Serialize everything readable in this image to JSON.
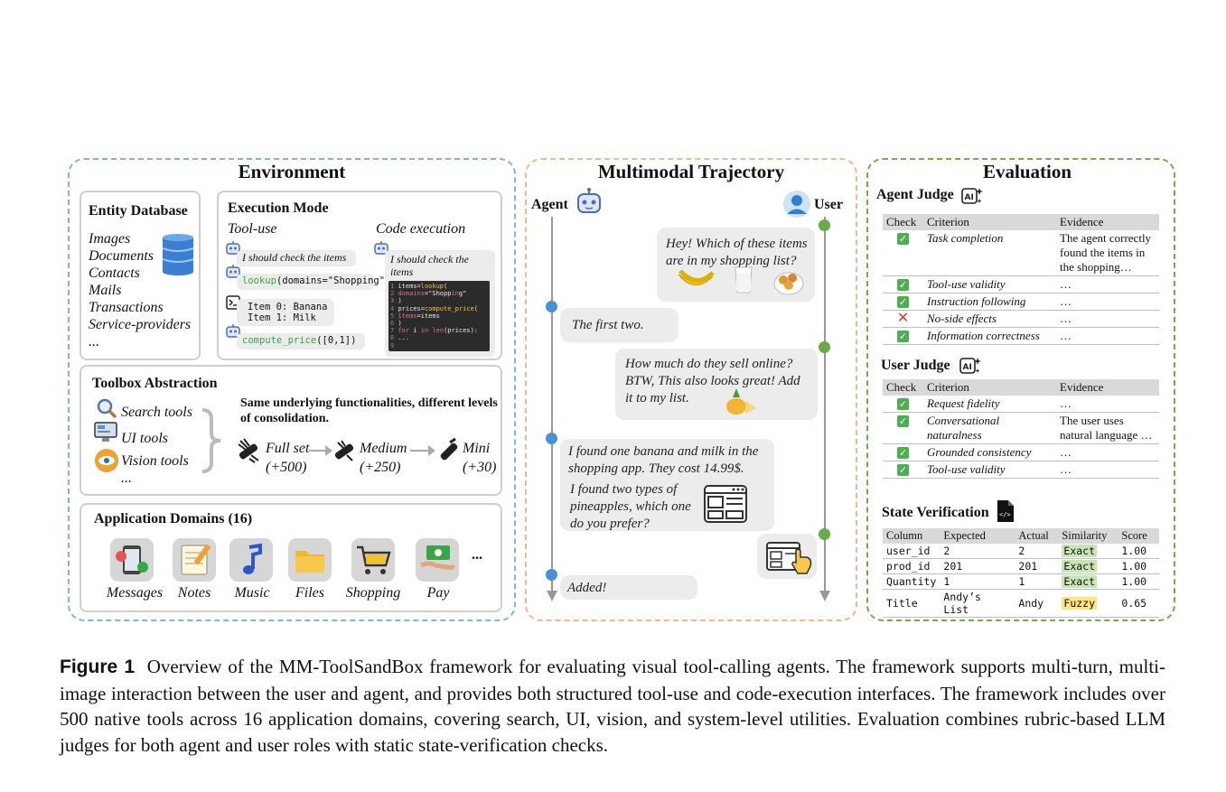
{
  "environment": {
    "title": "Environment",
    "entity_db": {
      "title": "Entity Database",
      "items": [
        "Images",
        "Documents",
        "Contacts",
        "Mails",
        "Transactions",
        "Service-providers",
        "..."
      ],
      "icon": "database-icon"
    },
    "exec_mode": {
      "title": "Execution Mode",
      "tool_use": {
        "label": "Tool-use",
        "thought1": "I should check the items",
        "call1_name": "lookup",
        "call1_args": "(domains=\"Shopping\")",
        "result_line1": "Item 0: Banana",
        "result_line2": "Item 1: Milk",
        "call2_name": "compute_price",
        "call2_args": "([0,1])"
      },
      "code_exec": {
        "label": "Code execution",
        "thought": "I should check the items",
        "code": [
          {
            "n": "1",
            "text": "items=lookup("
          },
          {
            "n": "2",
            "text": "    domains=\"Shopping\""
          },
          {
            "n": "3",
            "text": ")"
          },
          {
            "n": "4",
            "text": "prices=compute_price("
          },
          {
            "n": "5",
            "text": "    items=items"
          },
          {
            "n": "6",
            "text": ")"
          },
          {
            "n": "7",
            "text": "for i in len(prices):"
          },
          {
            "n": "8",
            "text": "    ..."
          },
          {
            "n": "9",
            "text": ""
          }
        ]
      }
    },
    "toolbox": {
      "title": "Toolbox Abstraction",
      "tools": [
        "Search tools",
        "UI tools",
        "Vision tools",
        "..."
      ],
      "note": "Same underlying functionalities, different levels of consolidation.",
      "levels": [
        {
          "name": "Full set",
          "count": "(+500)"
        },
        {
          "name": "Medium",
          "count": "(+250)"
        },
        {
          "name": "Mini",
          "count": "(+30)"
        }
      ]
    },
    "app_domains": {
      "title": "Application Domains (16)",
      "apps": [
        "Messages",
        "Notes",
        "Music",
        "Files",
        "Shopping",
        "Pay"
      ],
      "more": "..."
    }
  },
  "trajectory": {
    "title": "Multimodal Trajectory",
    "agent_label": "Agent",
    "user_label": "User",
    "messages": [
      {
        "role": "user",
        "text": "Hey! Which of these items are in my shopping list?"
      },
      {
        "role": "agent",
        "text": "The first two."
      },
      {
        "role": "user",
        "text": "How much do they sell online? BTW, This also looks great! Add it to my list."
      },
      {
        "role": "agent",
        "text": "I found one banana and milk in the shopping app. They cost 14.99$.",
        "text2": "I found two types of pineapples, which one do you prefer?"
      },
      {
        "role": "agent",
        "text": "Added!"
      }
    ]
  },
  "evaluation": {
    "title": "Evaluation",
    "agent_judge": {
      "title": "Agent Judge",
      "headers": [
        "Check",
        "Criterion",
        "Evidence"
      ],
      "rows": [
        {
          "check": "pass",
          "criterion": "Task completion",
          "evidence": "The agent correctly found the items in the shopping…"
        },
        {
          "check": "pass",
          "criterion": "Tool-use validity",
          "evidence": "…"
        },
        {
          "check": "pass",
          "criterion": "Instruction following",
          "evidence": "…"
        },
        {
          "check": "fail",
          "criterion": "No-side effects",
          "evidence": "…"
        },
        {
          "check": "pass",
          "criterion": "Information correctness",
          "evidence": "…"
        }
      ]
    },
    "user_judge": {
      "title": "User Judge",
      "headers": [
        "Check",
        "Criterion",
        "Evidence"
      ],
      "rows": [
        {
          "check": "pass",
          "criterion": "Request fidelity",
          "evidence": "…"
        },
        {
          "check": "pass",
          "criterion": "Conversational naturalness",
          "evidence": "The user uses natural language …"
        },
        {
          "check": "pass",
          "criterion": "Grounded consistency",
          "evidence": "…"
        },
        {
          "check": "pass",
          "criterion": "Tool-use validity",
          "evidence": "…"
        }
      ]
    },
    "state_verification": {
      "title": "State Verification",
      "headers": [
        "Column",
        "Expected",
        "Actual",
        "Similarity",
        "Score"
      ],
      "rows": [
        {
          "column": "user_id",
          "expected": "2",
          "actual": "2",
          "similarity": "Exact",
          "score": "1.00"
        },
        {
          "column": "prod_id",
          "expected": "201",
          "actual": "201",
          "similarity": "Exact",
          "score": "1.00"
        },
        {
          "column": "Quantity",
          "expected": "1",
          "actual": "1",
          "similarity": "Exact",
          "score": "1.00"
        },
        {
          "column": "Title",
          "expected": "Andy’s List",
          "actual": "Andy",
          "similarity": "Fuzzy",
          "score": "0.65"
        }
      ]
    }
  },
  "caption": {
    "label": "Figure 1",
    "text": "Overview of the MM-ToolSandBox framework for evaluating visual tool-calling agents. The framework supports multi-turn, multi-image interaction between the user and agent, and provides both structured tool-use and code-execution interfaces. The framework includes over 500 native tools across 16 application domains, covering search, UI, vision, and system-level utilities. Evaluation combines rubric-based LLM judges for both agent and user roles with static state-verification checks."
  },
  "colors": {
    "env_border": "#7fb3e6",
    "traj_border": "#f2b88a",
    "eval_border": "#6fae48",
    "node_blue": "#4a90d9",
    "node_green": "#6aaa48"
  }
}
